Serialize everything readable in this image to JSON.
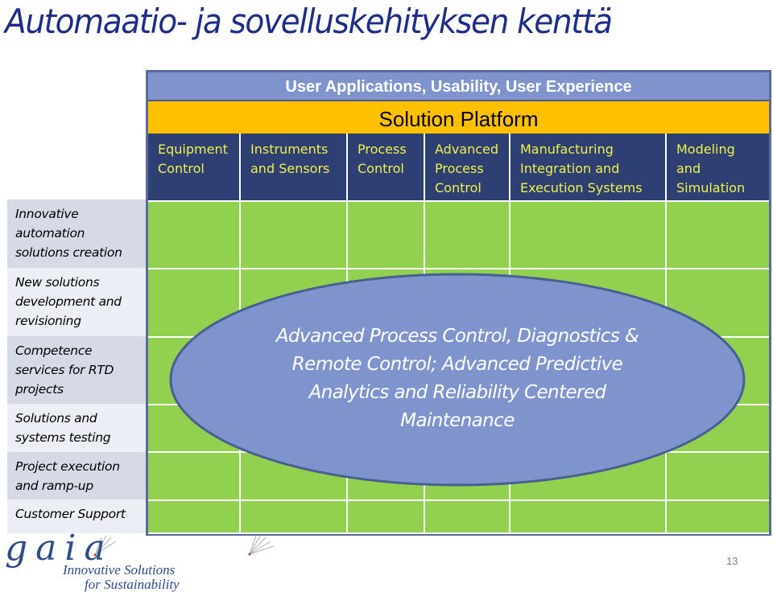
{
  "slide": {
    "title": "Automaatio- ja sovelluskehityksen kenttä",
    "page_number": "13"
  },
  "bands": {
    "top": "User Applications, Usability, User Experience",
    "platform": "Solution Platform"
  },
  "columns": [
    {
      "label": "Equipment Control",
      "lines": [
        "Equipment",
        "Control"
      ]
    },
    {
      "label": "Instruments and Sensors",
      "lines": [
        "Instruments",
        "and Sensors"
      ]
    },
    {
      "label": "Process Control",
      "lines": [
        "Process",
        "Control"
      ]
    },
    {
      "label": "Advanced Process Control",
      "lines": [
        "Advanced",
        "Process",
        "Control"
      ]
    },
    {
      "label": "Manufacturing Integration and Execution Systems",
      "lines": [
        "Manufacturing",
        "Integration and",
        "Execution Systems"
      ]
    },
    {
      "label": "Modeling and Simulation",
      "lines": [
        "Modeling",
        "and",
        "Simulation"
      ]
    }
  ],
  "rows": [
    {
      "label": "Innovative automation solutions creation",
      "lines": [
        "Innovative",
        "automation",
        "solutions creation"
      ]
    },
    {
      "label": "New solutions development and revisioning",
      "lines": [
        "New solutions",
        "development and",
        "revisioning"
      ]
    },
    {
      "label": "Competence services for RTD projects",
      "lines": [
        "Competence",
        "services for RTD",
        "projects"
      ]
    },
    {
      "label": "Solutions and systems testing",
      "lines": [
        "Solutions and",
        "systems testing"
      ]
    },
    {
      "label": "Project execution and ramp-up",
      "lines": [
        "Project execution",
        "and ramp-up"
      ]
    },
    {
      "label": "Customer Support",
      "lines": [
        "Customer Support"
      ]
    }
  ],
  "focus_area": {
    "lines": [
      "Advanced Process Control, Diagnostics &",
      "Remote Control; Advanced Predictive",
      "Analytics and Reliability Centered",
      "Maintenance"
    ]
  },
  "logo": {
    "word": "gaia",
    "tagline_line1": "Innovative Solutions",
    "tagline_line2": "for Sustainability"
  },
  "colors": {
    "title": "#1f2c8a",
    "top_band": "#7f94cc",
    "platform_band": "#ffc000",
    "column_header": "#2e3f73",
    "column_header_text": "#f0f04a",
    "grid_fill": "#92d050",
    "ellipse_fill": "#7f94cc",
    "ellipse_stroke": "#4a5f94"
  }
}
